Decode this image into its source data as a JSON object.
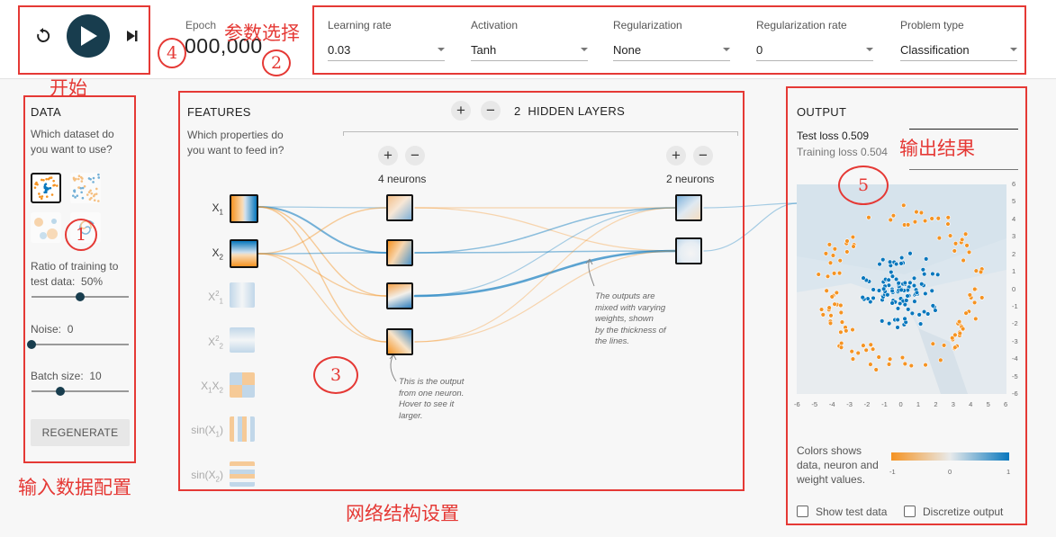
{
  "controls": {
    "reset_icon": "reset-icon",
    "play_icon": "play-icon",
    "step_icon": "step-icon"
  },
  "epoch": {
    "label": "Epoch",
    "value": "000,000"
  },
  "params": [
    {
      "label": "Learning rate",
      "value": "0.03"
    },
    {
      "label": "Activation",
      "value": "Tanh"
    },
    {
      "label": "Regularization",
      "value": "None"
    },
    {
      "label": "Regularization rate",
      "value": "0"
    },
    {
      "label": "Problem type",
      "value": "Classification"
    }
  ],
  "annotations": {
    "start": "开始",
    "params_select": "参数选择",
    "input_config": "输入数据配置",
    "network_setup": "网络结构设置",
    "output_result": "输出结果",
    "n1": "1",
    "n2": "2",
    "n3": "3",
    "n4": "4",
    "n5": "5"
  },
  "data_panel": {
    "title": "DATA",
    "question": "Which dataset do you want to use?",
    "ratio_label": "Ratio of training to test data:",
    "ratio_value": "50%",
    "ratio_level": 0.5,
    "noise_label": "Noise:",
    "noise_value": "0",
    "noise_level": 0,
    "batch_label": "Batch size:",
    "batch_value": "10",
    "batch_level": 0.3,
    "regenerate": "REGENERATE"
  },
  "features_panel": {
    "title": "FEATURES",
    "question": "Which properties do you want to feed in?",
    "hidden_layers_count": "2",
    "hidden_layers_label": "HIDDEN LAYERS",
    "layer1_neurons": "4 neurons",
    "layer2_neurons": "2 neurons",
    "features": [
      {
        "base": "X",
        "sub": "1",
        "sup": "",
        "active": true
      },
      {
        "base": "X",
        "sub": "2",
        "sup": "",
        "active": true
      },
      {
        "base": "X",
        "sub": "1",
        "sup": "2",
        "active": false
      },
      {
        "base": "X",
        "sub": "2",
        "sup": "2",
        "active": false
      },
      {
        "base": "X",
        "sub": "1",
        "sup": "",
        "base2": "X",
        "sub2": "2",
        "active": false
      },
      {
        "base": "sin(X",
        "sub": "1",
        "sup": "",
        "tail": ")",
        "active": false
      },
      {
        "base": "sin(X",
        "sub": "2",
        "sup": "",
        "tail": ")",
        "active": false
      }
    ],
    "tip_neuron": [
      "This is the output",
      "from one neuron.",
      "Hover to see it",
      "larger."
    ],
    "tip_weights": [
      "The outputs are",
      "mixed with varying",
      "weights, shown",
      "by the thickness of",
      "the lines."
    ]
  },
  "output_panel": {
    "title": "OUTPUT",
    "test_loss_label": "Test loss",
    "test_loss_value": "0.509",
    "training_loss_label": "Training loss",
    "training_loss_value": "0.504",
    "axis_ticks": [
      "-6",
      "-5",
      "-4",
      "-3",
      "-2",
      "-1",
      "0",
      "1",
      "2",
      "3",
      "4",
      "5",
      "6"
    ],
    "colors_text": [
      "Colors shows",
      "data, neuron and",
      "weight values."
    ],
    "legend_min": "-1",
    "legend_mid": "0",
    "legend_max": "1",
    "show_test_data": "Show test data",
    "discretize_output": "Discretize output"
  },
  "colors": {
    "orange": "#f59322",
    "blue": "#0877bd",
    "dark": "#183d4e",
    "annotation_red": "#e53935"
  }
}
